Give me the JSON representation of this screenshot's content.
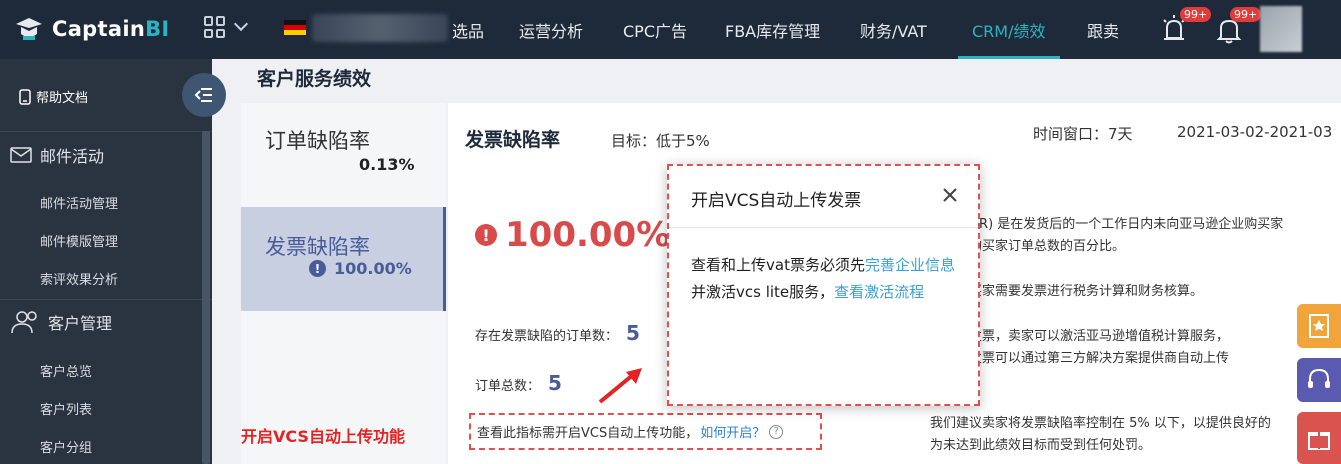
{
  "topbar": {
    "logo": {
      "prefix": "Captain",
      "suffix": "BI"
    },
    "nav": [
      {
        "label": "选品",
        "active": false
      },
      {
        "label": "运营分析",
        "active": false
      },
      {
        "label": "CPC广告",
        "active": false
      },
      {
        "label": "FBA库存管理",
        "active": false
      },
      {
        "label": "财务/VAT",
        "active": false
      },
      {
        "label": "CRM/绩效",
        "active": true
      },
      {
        "label": "跟卖",
        "active": false
      }
    ],
    "badges": [
      "99+",
      "99+"
    ]
  },
  "sidebar": {
    "help": "帮助文档",
    "sections": [
      {
        "label": "邮件活动",
        "items": [
          "邮件活动管理",
          "邮件模版管理",
          "索评效果分析"
        ]
      },
      {
        "label": "客户管理",
        "items": [
          "客户总览",
          "客户列表",
          "客户分组"
        ]
      }
    ]
  },
  "page": {
    "title": "客户服务绩效"
  },
  "tabs": [
    {
      "label": "订单缺陷率",
      "value": "0.13%"
    },
    {
      "label": "发票缺陷率",
      "value": "100.00%"
    }
  ],
  "vcs_note": "开启VCS自动上传功能",
  "card": {
    "title": "发票缺陷率",
    "target": "目标：低于5%",
    "window": "时间窗口：7天",
    "range": "2021-03-02-2021-03",
    "big_rate": "100.00%",
    "defect_orders_label": "存在发票缺陷的订单数：",
    "defect_orders_value": "5",
    "total_orders_label": "订单总数：",
    "total_orders_value": "5",
    "hint_text": "查看此指标需开启VCS自动上传功能，",
    "hint_link": "如何开启？",
    "desc_lines": [
      "陷率 (IDR) 是在发货后的一个工作日内未向亚马逊企业购买家",
      "逊企业购买家订单总数的百分比。",
      "企业购买家需要发票进行税务计算和财务核算。",
      "家提供发票，卖家可以激活亚马逊增值税计算服务，",
      "或者，发票可以通过第三方解决方案提供商自动上传",
      "我们建议卖家将发票缺陷率控制在 5% 以下，以提供良好的",
      "为未达到此绩效目标而受到任何处罚。"
    ]
  },
  "modal": {
    "title": "开启VCS自动上传发票",
    "body_pre": "查看和上传vat票务必须先",
    "link1": "完善企业信息",
    "body_mid": "并激活vcs lite服务，",
    "link2": "查看激活流程"
  },
  "colors": {
    "nav_bg": "#1e2a3a",
    "accent": "#2bb3c0",
    "danger": "#d94a4a",
    "indigo": "#4a5b99"
  }
}
